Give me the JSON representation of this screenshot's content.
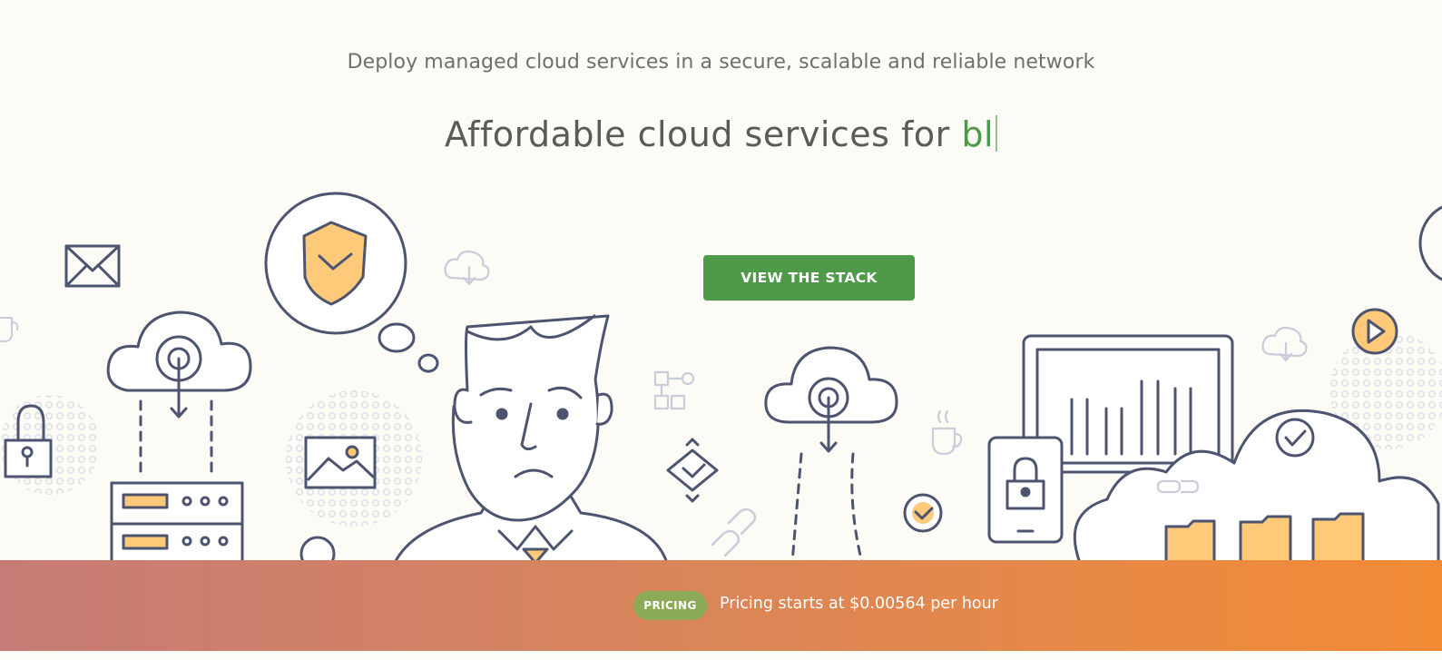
{
  "hero": {
    "tagline": "Deploy managed cloud services in a secure, scalable and reliable network",
    "headline_prefix": "Affordable cloud services for",
    "headline_typed": "bl",
    "cta_label": "VIEW THE STACK"
  },
  "banner": {
    "badge_label": "PRICING",
    "text": "Pricing starts at $0.00564 per hour"
  },
  "colors": {
    "background": "#fdfbf5",
    "cta": "#4f9a48",
    "typed_text": "#4a9a46",
    "badge": "#8aaa57",
    "banner_gradient_start": "#c77b77",
    "banner_gradient_end": "#f38b35",
    "line_art": "#4c5470",
    "accent_fill": "#ffc97a"
  },
  "icons": [
    "envelope-icon",
    "shield-thought-bubble-icon",
    "cloud-download-icon",
    "cloud-upload-icon",
    "padlock-icon",
    "server-rack-icon",
    "image-frame-icon",
    "person-illustration",
    "flowchart-icon",
    "diamond-check-icon",
    "cloud-sync-icon",
    "coffee-cup-icon",
    "chain-link-icon",
    "check-circle-icon",
    "monitor-chart-icon",
    "phone-lock-icon",
    "big-cloud-icon",
    "folder-icon",
    "play-button-icon"
  ]
}
